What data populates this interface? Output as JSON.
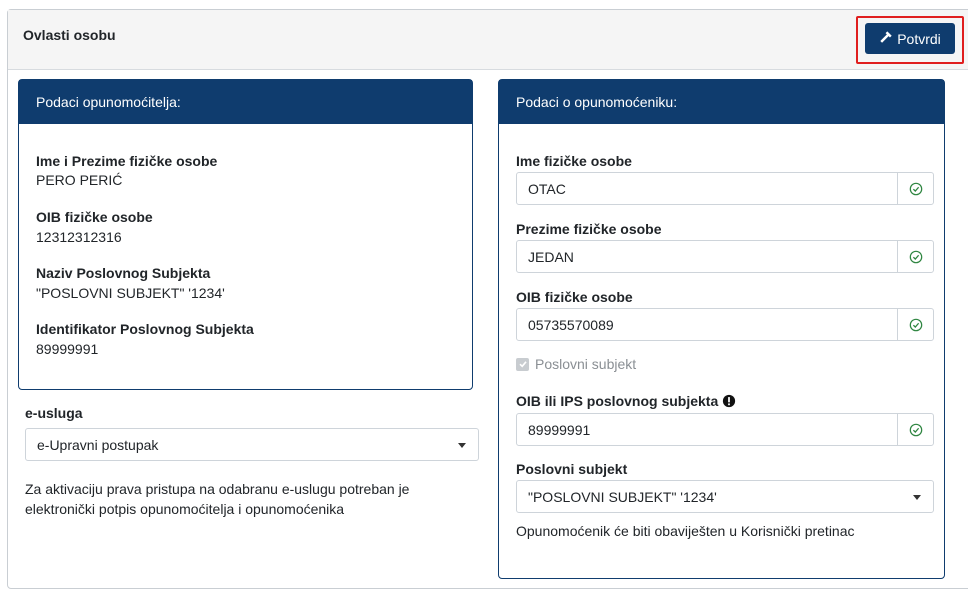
{
  "header": {
    "title": "Ovlasti osobu",
    "confirm_label": "Potvrdi",
    "confirm_icon": "hammer-icon"
  },
  "left": {
    "heading": "Podaci opunomoćitelja:",
    "fields": [
      {
        "label": "Ime i Prezime fizičke osobe",
        "value": "PERO PERIĆ"
      },
      {
        "label": "OIB fizičke osobe",
        "value": "12312312316"
      },
      {
        "label": "Naziv Poslovnog Subjekta",
        "value": "\"POSLOVNI SUBJEKT\" '1234'"
      },
      {
        "label": "Identifikator Poslovnog Subjekta",
        "value": "89999991"
      }
    ]
  },
  "eusluga": {
    "label": "e-usluga",
    "selected": "e-Upravni postupak",
    "note_line1": "Za aktivaciju prava pristupa na odabranu e-uslugu potreban je",
    "note_line2": "elektronički potpis opunomoćitelja i opunomoćenika"
  },
  "right": {
    "heading": "Podaci o opunomoćeniku:",
    "first_name_label": "Ime fizičke osobe",
    "first_name_value": "OTAC",
    "last_name_label": "Prezime fizičke osobe",
    "last_name_value": "JEDAN",
    "oib_label": "OIB fizičke osobe",
    "oib_value": "05735570089",
    "business_checkbox_label": "Poslovni subjekt",
    "business_checkbox_checked": true,
    "business_oib_label": "OIB ili IPS poslovnog subjekta",
    "business_oib_value": "89999991",
    "business_label": "Poslovni subjekt",
    "business_selected": "\"POSLOVNI SUBJEKT\" '1234'",
    "notice": "Opunomoćenik će biti obaviješten u Korisnički pretinac"
  },
  "colors": {
    "primary": "#0f3c6e",
    "success": "#2e8540",
    "highlight": "#e01e1e"
  }
}
